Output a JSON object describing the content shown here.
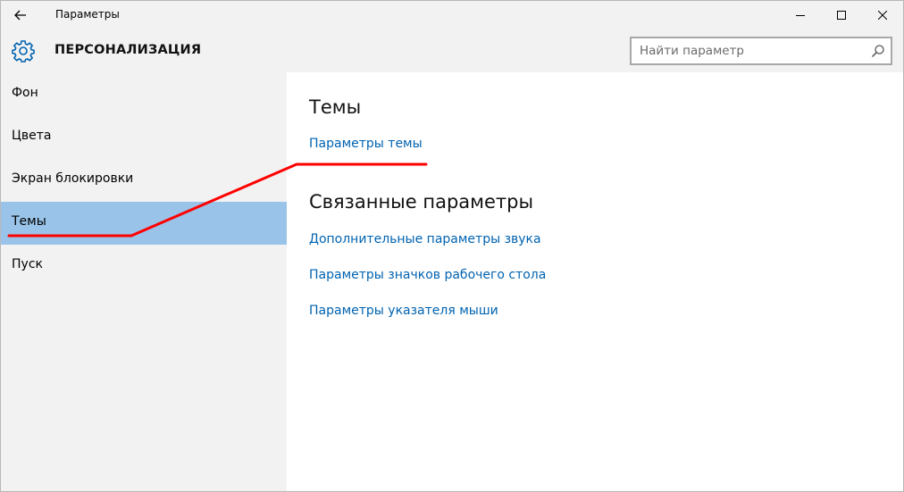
{
  "window": {
    "title": "Параметры",
    "back_icon": "back-arrow-icon",
    "controls": [
      "minimize-icon",
      "maximize-icon",
      "close-icon"
    ]
  },
  "header": {
    "icon": "gear-icon",
    "title": "ПЕРСОНАЛИЗАЦИЯ",
    "search_placeholder": "Найти параметр",
    "search_icon": "search-icon"
  },
  "sidebar": {
    "items": [
      {
        "label": "Фон",
        "selected": false
      },
      {
        "label": "Цвета",
        "selected": false
      },
      {
        "label": "Экран блокировки",
        "selected": false
      },
      {
        "label": "Темы",
        "selected": true
      },
      {
        "label": "Пуск",
        "selected": false
      }
    ]
  },
  "main": {
    "themes_title": "Темы",
    "theme_settings_link": "Параметры темы",
    "related_title": "Связанные параметры",
    "related_links": [
      "Дополнительные параметры звука",
      "Параметры значков рабочего стола",
      "Параметры указателя мыши"
    ]
  },
  "colors": {
    "accent": "#0063b1",
    "selected_bg": "#99c3e8",
    "chrome_bg": "#f2f2f2",
    "annotation": "#ff0000"
  }
}
